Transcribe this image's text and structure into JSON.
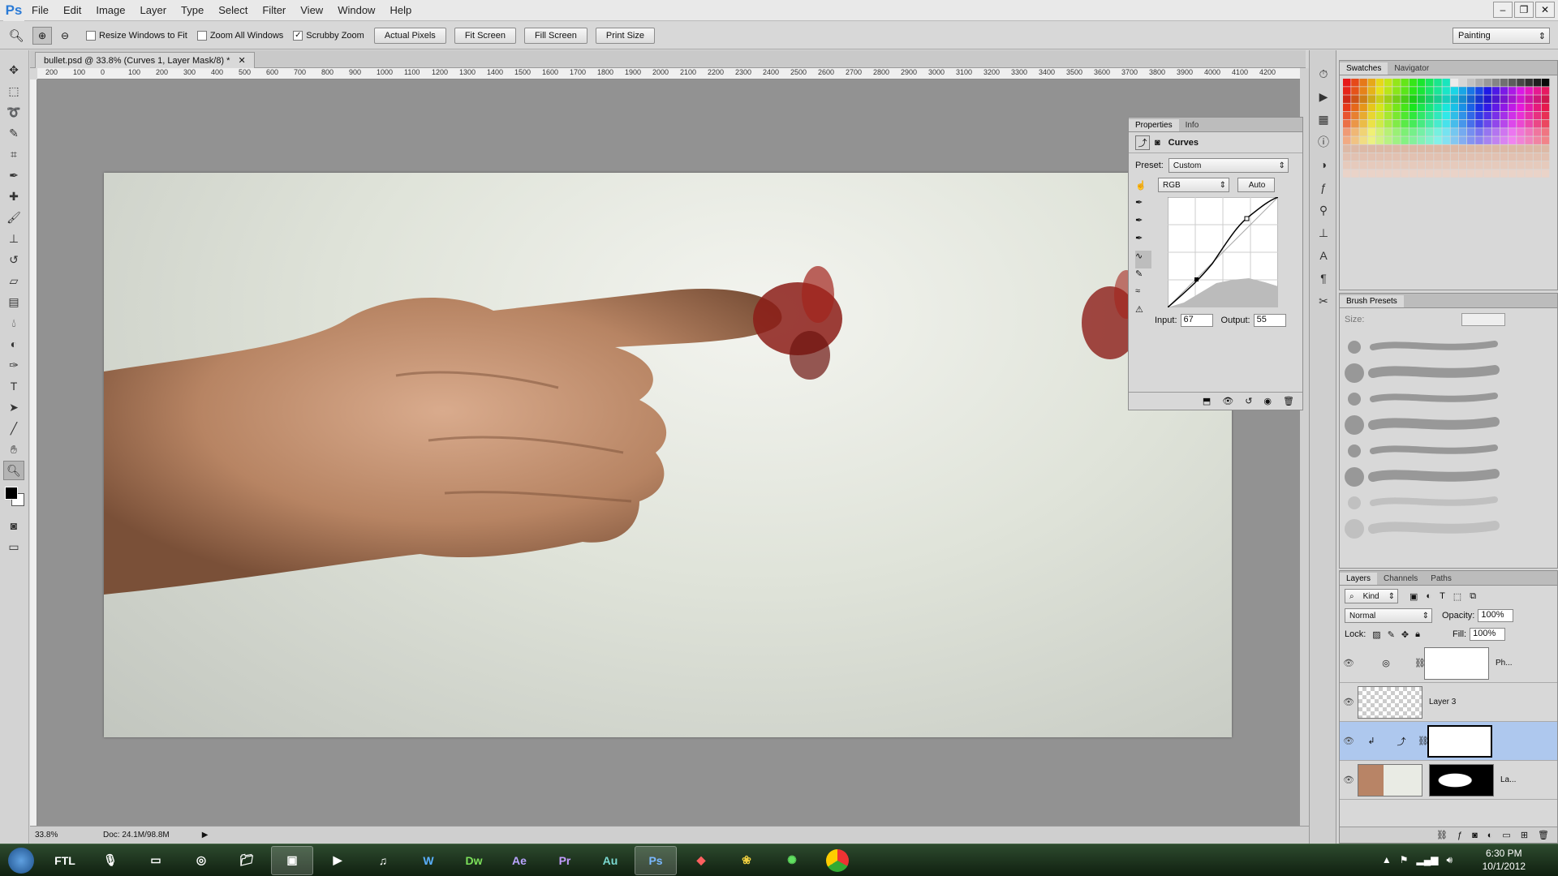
{
  "app": {
    "logo": "Ps"
  },
  "menu": [
    "File",
    "Edit",
    "Image",
    "Layer",
    "Type",
    "Select",
    "Filter",
    "View",
    "Window",
    "Help"
  ],
  "window_controls": [
    "–",
    "❐",
    "✕"
  ],
  "options": {
    "resize_windows": "Resize Windows to Fit",
    "zoom_all": "Zoom All Windows",
    "scrubby": "Scrubby Zoom",
    "buttons": [
      "Actual Pixels",
      "Fit Screen",
      "Fill Screen",
      "Print Size"
    ],
    "workspace": "Painting"
  },
  "document": {
    "tab_title": "bullet.psd @ 33.8% (Curves 1, Layer Mask/8) *",
    "zoom": "33.8%",
    "doc_size": "Doc: 24.1M/98.8M",
    "ruler_labels": [
      "200",
      "100",
      "0",
      "100",
      "200",
      "300",
      "400",
      "500",
      "600",
      "700",
      "800",
      "900",
      "1000",
      "1100",
      "1200",
      "1300",
      "1400",
      "1500",
      "1600",
      "1700",
      "1800",
      "1900",
      "2000",
      "2100",
      "2200",
      "2300",
      "2400",
      "2500",
      "2600",
      "2700",
      "2800",
      "2900",
      "3000",
      "3100",
      "3200",
      "3300",
      "3400",
      "3500",
      "3600",
      "3700",
      "3800",
      "3900",
      "4000",
      "4100",
      "4200"
    ]
  },
  "properties": {
    "tabs": [
      "Properties",
      "Info"
    ],
    "title": "Curves",
    "preset_label": "Preset:",
    "preset_value": "Custom",
    "channel": "RGB",
    "auto": "Auto",
    "input_label": "Input:",
    "input_value": "67",
    "output_label": "Output:",
    "output_value": "55"
  },
  "swatches": {
    "tabs": [
      "Swatches",
      "Navigator"
    ]
  },
  "brushes": {
    "title": "Brush Presets",
    "size_label": "Size:"
  },
  "layers": {
    "tabs": [
      "Layers",
      "Channels",
      "Paths"
    ],
    "kind": "Kind",
    "blend": "Normal",
    "opacity_label": "Opacity:",
    "opacity": "100%",
    "lock_label": "Lock:",
    "fill_label": "Fill:",
    "fill": "100%",
    "rows": [
      {
        "name": "Ph..."
      },
      {
        "name": "Layer 3"
      },
      {
        "name": ""
      },
      {
        "name": "La..."
      }
    ]
  },
  "taskbar": {
    "time": "6:30 PM",
    "date": "10/1/2012",
    "apps": [
      "FTL",
      "Dw",
      "Ae",
      "Pr",
      "Au",
      "Ps"
    ]
  }
}
